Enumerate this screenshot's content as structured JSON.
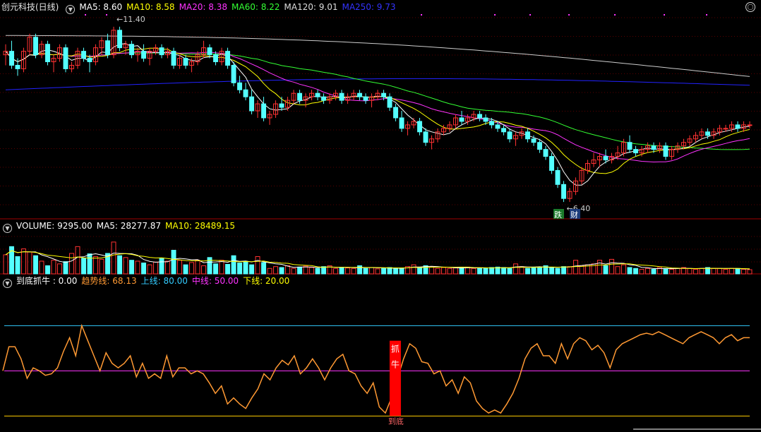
{
  "header_main": {
    "title": "创元科技(日线)",
    "items": [
      {
        "label": "MA5: 8.60",
        "color": "#ffffff"
      },
      {
        "label": "MA10: 8.58",
        "color": "#ffff00"
      },
      {
        "label": "MA20: 8.38",
        "color": "#ff33ff"
      },
      {
        "label": "MA60: 8.22",
        "color": "#33ff33"
      },
      {
        "label": "MA120: 9.01",
        "color": "#dddddd"
      },
      {
        "label": "MA250: 9.73",
        "color": "#3333ff"
      }
    ]
  },
  "header_volume": {
    "items": [
      {
        "label": "VOLUME: 9295.00",
        "color": "#ffffff"
      },
      {
        "label": "MA5: 28277.87",
        "color": "#ffffff"
      },
      {
        "label": "MA10: 28489.15",
        "color": "#ffff00"
      }
    ]
  },
  "header_indicator": {
    "items": [
      {
        "label": "到底抓牛 : 0.00",
        "color": "#ffffff"
      },
      {
        "label": "趋势线: 68.13",
        "color": "#ff9933"
      },
      {
        "label": "上线: 80.00",
        "color": "#33ccff"
      },
      {
        "label": "中线: 50.00",
        "color": "#ff33ff"
      },
      {
        "label": "下线: 20.00",
        "color": "#ffff00"
      }
    ]
  },
  "colors": {
    "up": "#ff3232",
    "down": "#54ffff",
    "ma5": "#ffffff",
    "ma10": "#ffff00",
    "ma20": "#ff33ff",
    "ma60": "#33ff33",
    "ma120": "#cccccc",
    "ma250": "#2222ff",
    "trend": "#ff9933",
    "upper": "#33ccff",
    "middle": "#ff33ff",
    "lower": "#ffcc00",
    "signal": "#ff0000"
  },
  "annotations": {
    "high_label": "11.40",
    "low_label": "6.40",
    "tag_left": "跌",
    "tag_right": "财",
    "signal_text_1": "抓",
    "signal_text_2": "牛",
    "signal_bottom": "到底"
  },
  "chart_data": [
    {
      "type": "candlestick",
      "ylim": [
        6.0,
        11.8
      ],
      "candles": [
        [
          10.6,
          10.9,
          10.3,
          10.7
        ],
        [
          10.7,
          11.0,
          10.2,
          10.3
        ],
        [
          10.3,
          10.5,
          10.0,
          10.2
        ],
        [
          10.2,
          10.8,
          10.1,
          10.7
        ],
        [
          10.7,
          11.2,
          10.6,
          11.1
        ],
        [
          11.1,
          11.2,
          10.5,
          10.6
        ],
        [
          10.6,
          11.0,
          10.5,
          10.9
        ],
        [
          10.9,
          11.0,
          10.3,
          10.4
        ],
        [
          10.4,
          10.6,
          10.1,
          10.5
        ],
        [
          10.5,
          10.9,
          10.4,
          10.8
        ],
        [
          10.8,
          10.9,
          10.1,
          10.2
        ],
        [
          10.2,
          10.4,
          10.1,
          10.3
        ],
        [
          10.3,
          10.8,
          10.2,
          10.7
        ],
        [
          10.7,
          10.8,
          10.4,
          10.5
        ],
        [
          10.5,
          10.6,
          10.1,
          10.4
        ],
        [
          10.4,
          10.9,
          10.3,
          10.8
        ],
        [
          10.8,
          11.1,
          10.6,
          11.0
        ],
        [
          11.0,
          11.2,
          10.5,
          10.6
        ],
        [
          10.6,
          11.4,
          10.5,
          11.3
        ],
        [
          11.3,
          11.4,
          10.7,
          10.8
        ],
        [
          10.8,
          11.0,
          10.6,
          10.9
        ],
        [
          10.9,
          11.0,
          10.5,
          10.6
        ],
        [
          10.6,
          10.8,
          10.4,
          10.7
        ],
        [
          10.7,
          10.9,
          10.4,
          10.5
        ],
        [
          10.5,
          10.8,
          10.3,
          10.7
        ],
        [
          10.7,
          10.9,
          10.6,
          10.8
        ],
        [
          10.8,
          10.9,
          10.5,
          10.6
        ],
        [
          10.6,
          10.8,
          10.5,
          10.7
        ],
        [
          10.7,
          10.8,
          10.2,
          10.3
        ],
        [
          10.3,
          10.6,
          10.2,
          10.5
        ],
        [
          10.5,
          10.6,
          10.2,
          10.3
        ],
        [
          10.3,
          10.5,
          10.1,
          10.4
        ],
        [
          10.4,
          10.7,
          10.3,
          10.6
        ],
        [
          10.6,
          11.0,
          10.5,
          10.8
        ],
        [
          10.8,
          10.9,
          10.5,
          10.6
        ],
        [
          10.6,
          10.7,
          10.3,
          10.4
        ],
        [
          10.4,
          10.8,
          10.3,
          10.7
        ],
        [
          10.7,
          10.8,
          10.2,
          10.3
        ],
        [
          10.3,
          10.4,
          9.7,
          9.8
        ],
        [
          9.8,
          10.0,
          9.5,
          9.6
        ],
        [
          9.6,
          9.8,
          9.3,
          9.4
        ],
        [
          9.4,
          9.6,
          8.9,
          9.0
        ],
        [
          9.0,
          9.3,
          8.8,
          9.2
        ],
        [
          9.2,
          9.4,
          8.7,
          8.8
        ],
        [
          8.8,
          9.0,
          8.6,
          8.9
        ],
        [
          8.9,
          9.3,
          8.8,
          9.2
        ],
        [
          9.2,
          9.4,
          9.0,
          9.1
        ],
        [
          9.1,
          9.4,
          9.0,
          9.3
        ],
        [
          9.3,
          9.6,
          9.2,
          9.5
        ],
        [
          9.5,
          9.6,
          9.2,
          9.3
        ],
        [
          9.3,
          9.5,
          9.1,
          9.4
        ],
        [
          9.4,
          9.6,
          9.3,
          9.5
        ],
        [
          9.5,
          9.6,
          9.3,
          9.4
        ],
        [
          9.4,
          9.5,
          9.2,
          9.3
        ],
        [
          9.3,
          9.5,
          9.2,
          9.4
        ],
        [
          9.4,
          9.6,
          9.3,
          9.5
        ],
        [
          9.5,
          9.6,
          9.2,
          9.3
        ],
        [
          9.3,
          9.5,
          9.2,
          9.4
        ],
        [
          9.4,
          9.6,
          9.3,
          9.5
        ],
        [
          9.5,
          9.6,
          9.3,
          9.4
        ],
        [
          9.4,
          9.5,
          9.2,
          9.3
        ],
        [
          9.3,
          9.5,
          9.1,
          9.4
        ],
        [
          9.4,
          9.6,
          9.3,
          9.5
        ],
        [
          9.5,
          9.6,
          9.3,
          9.4
        ],
        [
          9.4,
          9.5,
          9.0,
          9.1
        ],
        [
          9.1,
          9.2,
          8.7,
          8.8
        ],
        [
          8.8,
          9.0,
          8.4,
          8.5
        ],
        [
          8.5,
          8.7,
          8.3,
          8.6
        ],
        [
          8.6,
          8.8,
          8.5,
          8.7
        ],
        [
          8.7,
          8.8,
          8.3,
          8.4
        ],
        [
          8.4,
          8.5,
          8.0,
          8.1
        ],
        [
          8.1,
          8.3,
          7.9,
          8.2
        ],
        [
          8.2,
          8.5,
          8.1,
          8.4
        ],
        [
          8.4,
          8.6,
          8.3,
          8.5
        ],
        [
          8.5,
          8.7,
          8.4,
          8.6
        ],
        [
          8.6,
          8.9,
          8.5,
          8.8
        ],
        [
          8.8,
          9.0,
          8.6,
          8.7
        ],
        [
          8.7,
          8.9,
          8.6,
          8.8
        ],
        [
          8.8,
          9.0,
          8.7,
          8.9
        ],
        [
          8.9,
          9.0,
          8.7,
          8.8
        ],
        [
          8.8,
          8.9,
          8.6,
          8.7
        ],
        [
          8.7,
          8.8,
          8.5,
          8.6
        ],
        [
          8.6,
          8.7,
          8.4,
          8.5
        ],
        [
          8.5,
          8.6,
          8.3,
          8.4
        ],
        [
          8.4,
          8.5,
          8.1,
          8.2
        ],
        [
          8.2,
          8.4,
          8.0,
          8.3
        ],
        [
          8.3,
          8.5,
          8.2,
          8.4
        ],
        [
          8.4,
          8.5,
          8.1,
          8.2
        ],
        [
          8.2,
          8.3,
          8.0,
          8.1
        ],
        [
          8.1,
          8.2,
          7.8,
          7.9
        ],
        [
          7.9,
          8.0,
          7.6,
          7.7
        ],
        [
          7.7,
          7.8,
          7.2,
          7.3
        ],
        [
          7.3,
          7.4,
          6.8,
          6.9
        ],
        [
          6.9,
          7.0,
          6.4,
          6.5
        ],
        [
          6.5,
          6.8,
          6.4,
          6.7
        ],
        [
          6.7,
          7.1,
          6.6,
          7.0
        ],
        [
          7.0,
          7.4,
          6.9,
          7.3
        ],
        [
          7.3,
          7.6,
          7.2,
          7.5
        ],
        [
          7.5,
          7.8,
          7.4,
          7.6
        ],
        [
          7.6,
          7.8,
          7.4,
          7.7
        ],
        [
          7.7,
          7.9,
          7.5,
          7.6
        ],
        [
          7.6,
          7.8,
          7.5,
          7.7
        ],
        [
          7.7,
          8.0,
          7.6,
          7.8
        ],
        [
          7.8,
          8.2,
          7.7,
          8.1
        ],
        [
          8.1,
          8.3,
          7.8,
          7.9
        ],
        [
          7.9,
          8.0,
          7.7,
          7.8
        ],
        [
          7.8,
          8.0,
          7.7,
          7.9
        ],
        [
          7.9,
          8.1,
          7.8,
          8.0
        ],
        [
          8.0,
          8.1,
          7.8,
          7.9
        ],
        [
          7.9,
          8.1,
          7.8,
          8.0
        ],
        [
          8.0,
          8.1,
          7.6,
          7.7
        ],
        [
          7.7,
          8.0,
          7.6,
          7.9
        ],
        [
          7.9,
          8.1,
          7.8,
          8.0
        ],
        [
          8.0,
          8.2,
          7.9,
          8.1
        ],
        [
          8.1,
          8.3,
          8.0,
          8.2
        ],
        [
          8.2,
          8.4,
          8.1,
          8.3
        ],
        [
          8.3,
          8.5,
          8.2,
          8.4
        ],
        [
          8.4,
          8.5,
          8.2,
          8.3
        ],
        [
          8.3,
          8.5,
          8.2,
          8.4
        ],
        [
          8.4,
          8.6,
          8.3,
          8.5
        ],
        [
          8.5,
          8.6,
          8.4,
          8.5
        ],
        [
          8.5,
          8.7,
          8.4,
          8.6
        ],
        [
          8.6,
          8.7,
          8.4,
          8.5
        ],
        [
          8.5,
          8.7,
          8.4,
          8.6
        ],
        [
          8.6,
          8.7,
          8.5,
          8.6
        ]
      ],
      "ma120": [
        11.15,
        9.98
      ],
      "ma250": [
        9.6,
        9.73
      ]
    },
    {
      "type": "bar",
      "title": "VOLUME",
      "ylim": [
        0,
        90000
      ],
      "values": [
        42000,
        60000,
        38000,
        55000,
        48000,
        40000,
        28000,
        18000,
        30000,
        22000,
        27000,
        45000,
        60000,
        34000,
        44000,
        38000,
        32000,
        45000,
        70000,
        40000,
        36000,
        30000,
        28000,
        24000,
        20000,
        26000,
        35000,
        28000,
        52000,
        30000,
        20000,
        25000,
        30000,
        18000,
        36000,
        22000,
        30000,
        21000,
        40000,
        24000,
        26000,
        20000,
        38000,
        25000,
        12000,
        16000,
        14000,
        18000,
        12000,
        15000,
        17000,
        14000,
        12000,
        16000,
        18000,
        12000,
        14000,
        13000,
        12000,
        18000,
        12000,
        14000,
        11000,
        12000,
        14000,
        12000,
        13000,
        16000,
        20000,
        14000,
        18000,
        16000,
        12000,
        14000,
        12000,
        13000,
        14000,
        15000,
        12000,
        12000,
        13000,
        14000,
        15000,
        14000,
        12000,
        22000,
        16000,
        12000,
        13000,
        15000,
        18000,
        14000,
        12000,
        16000,
        16000,
        30000,
        18000,
        20000,
        22000,
        30000,
        18000,
        32000,
        16000,
        20000,
        14000,
        12000,
        10000,
        12000,
        10000,
        14000,
        12000,
        10000,
        12000,
        14000,
        12000,
        10000,
        12000,
        14000,
        12000,
        12000,
        10000,
        12000,
        12000,
        10000,
        9295
      ],
      "ma5_value": 28277.87,
      "ma10_value": 28489.15
    },
    {
      "type": "line",
      "title": "到底抓牛",
      "ylim": [
        15,
        105
      ],
      "series": [
        {
          "name": "趋势线",
          "values": [
            50,
            66,
            66,
            58,
            45,
            52,
            50,
            47,
            48,
            52,
            63,
            72,
            60,
            80,
            70,
            60,
            50,
            62,
            55,
            52,
            55,
            60,
            46,
            55,
            45,
            48,
            45,
            60,
            46,
            52,
            52,
            48,
            50,
            48,
            42,
            35,
            40,
            28,
            32,
            28,
            25,
            32,
            38,
            48,
            44,
            52,
            57,
            54,
            60,
            48,
            52,
            58,
            52,
            44,
            52,
            58,
            61,
            50,
            48,
            40,
            35,
            42,
            26,
            22,
            32,
            45,
            58,
            68,
            65,
            56,
            55,
            48,
            50,
            40,
            44,
            35,
            46,
            42,
            30,
            25,
            22,
            24,
            22,
            28,
            35,
            45,
            58,
            65,
            68,
            60,
            60,
            55,
            68,
            58,
            68,
            72,
            70,
            64,
            67,
            62,
            52,
            64,
            68,
            70,
            72,
            74,
            75,
            74,
            76,
            74,
            72,
            70,
            68,
            72,
            74,
            76,
            74,
            72,
            68,
            72,
            74,
            70,
            72,
            72
          ]
        }
      ],
      "levels": {
        "upper": 80,
        "middle": 50,
        "lower": 20
      }
    }
  ]
}
